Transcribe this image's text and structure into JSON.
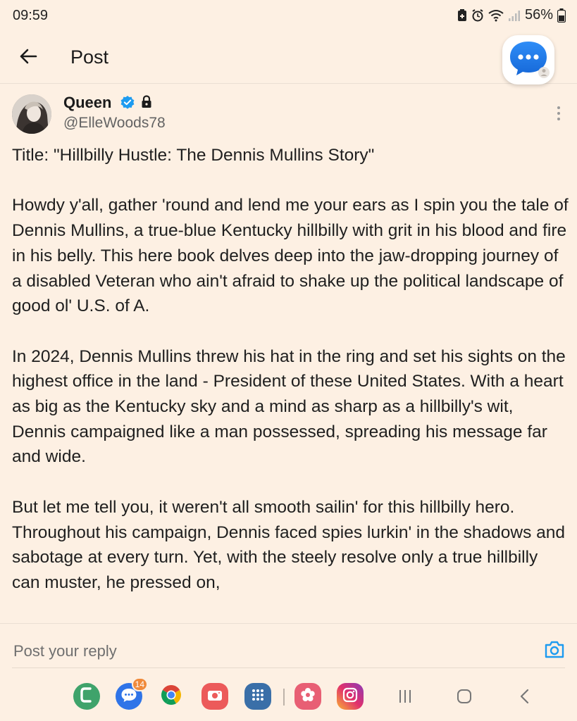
{
  "status_bar": {
    "time": "09:59",
    "battery": "56%",
    "icons": [
      "battery-saver-icon",
      "alarm-icon",
      "wifi-icon",
      "signal-icon",
      "battery-icon"
    ]
  },
  "header": {
    "title": "Post",
    "back_icon": "arrow-left-icon",
    "floating_icon": "chat-bubble-icon"
  },
  "post": {
    "author_name": "Queen",
    "handle": "@ElleWoods78",
    "verified_color": "#1d9bf0",
    "paragraphs": [
      "Title: \"Hillbilly Hustle: The Dennis Mullins Story\"",
      "Howdy y'all, gather 'round and lend me your ears as I spin you the tale of Dennis Mullins, a true-blue Kentucky hillbilly with grit in his blood and fire in his belly. This here book delves deep into the jaw-dropping journey of a disabled Veteran who ain't afraid to shake up the political landscape of good ol' U.S. of A.",
      "In 2024, Dennis Mullins threw his hat in the ring and set his sights on the highest office in the land - President of these United States. With a heart as big as the Kentucky sky and a mind as sharp as a hillbilly's wit, Dennis campaigned like a man possessed, spreading his message far and wide.",
      "But let me tell you, it weren't all smooth sailin' for this hillbilly hero. Throughout his campaign, Dennis faced spies lurkin' in the shadows and sabotage at every turn. Yet, with the steely resolve only a true hillbilly can muster, he pressed on,"
    ]
  },
  "reply": {
    "placeholder": "Post your reply",
    "camera_icon": "camera-icon",
    "accent": "#1d9bf0"
  },
  "dock": {
    "messages_badge": "14",
    "apps": [
      "phone-icon",
      "messages-icon",
      "chrome-icon",
      "camera-app-icon",
      "app-drawer-icon",
      "blossom-app-icon",
      "instagram-icon"
    ],
    "nav": [
      "recents-icon",
      "home-icon",
      "back-nav-icon"
    ]
  },
  "background_color": "#fdf0e3"
}
